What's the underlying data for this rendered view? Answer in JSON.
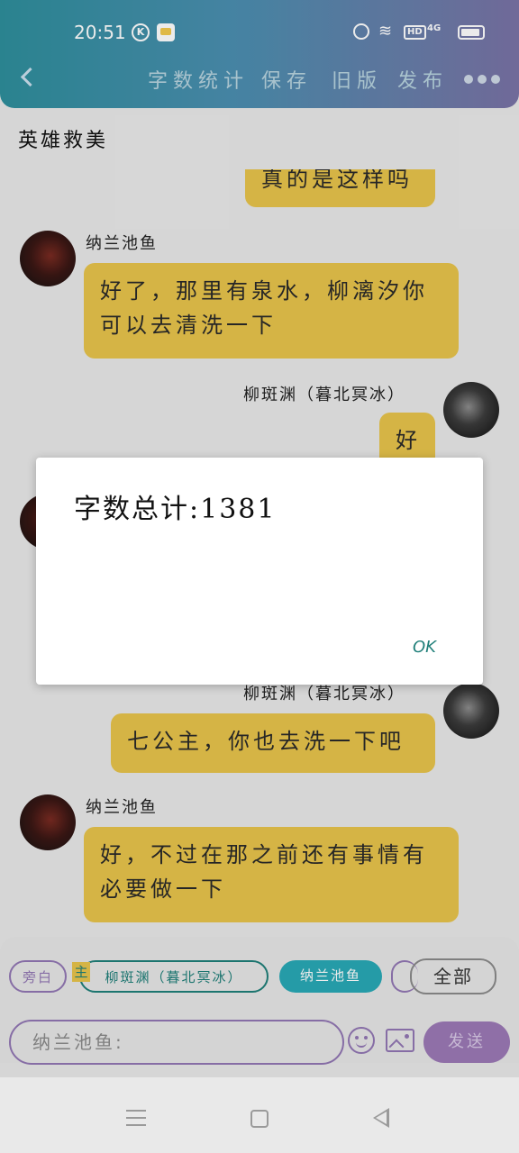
{
  "status_bar": {
    "time": "20:51",
    "hd": "HD",
    "network": "4G"
  },
  "nav": {
    "menu": [
      "字数统计",
      "保存",
      "旧版",
      "发布"
    ]
  },
  "title": "英雄救美",
  "messages": [
    {
      "speaker": "",
      "text": "真的是这样吗",
      "side": "right"
    },
    {
      "speaker": "纳兰池鱼",
      "text": "好了，那里有泉水，柳漓汐你可以去清洗一下",
      "side": "left"
    },
    {
      "speaker": "柳斑渊（暮北冥冰）",
      "text": "好",
      "side": "right"
    },
    {
      "speaker": "柳斑渊（暮北冥冰）",
      "text": "七公主，你也去洗一下吧",
      "side": "right"
    },
    {
      "speaker": "纳兰池鱼",
      "text": "好，不过在那之前还有事情有必要做一下",
      "side": "left"
    }
  ],
  "chips": {
    "narration": "旁白",
    "main_tag": "主",
    "liu": "柳斑渊（暮北冥冰）",
    "nalan": "纳兰池鱼",
    "all": "全部"
  },
  "composer": {
    "placeholder": "纳兰池鱼:",
    "send": "发送"
  },
  "dialog": {
    "message": "字数总计:1381",
    "ok": "OK"
  },
  "colors": {
    "bubble": "#e8c44b",
    "accent_purple": "#9277b4",
    "accent_teal": "#1f7f79",
    "chip_active": "#29a9b6"
  }
}
